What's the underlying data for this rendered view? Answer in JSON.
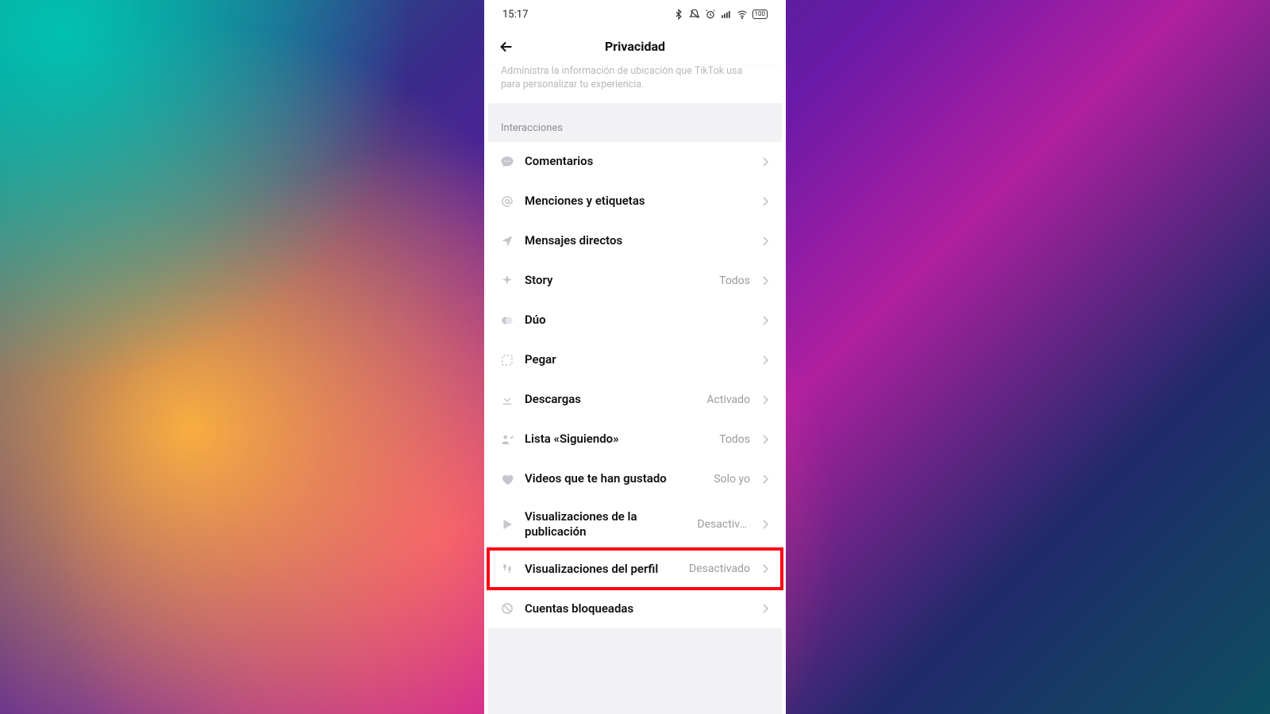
{
  "statusbar": {
    "time": "15:17",
    "battery": "100"
  },
  "header": {
    "title": "Privacidad"
  },
  "info_card": {
    "line1": "Administra la información de ubicación que TikTok usa",
    "line2": "para personalizar tu experiencia."
  },
  "section": {
    "title": "Interacciones"
  },
  "rows": {
    "comentarios": {
      "label": "Comentarios",
      "value": ""
    },
    "menciones": {
      "label": "Menciones y etiquetas",
      "value": ""
    },
    "mensajes": {
      "label": "Mensajes directos",
      "value": ""
    },
    "story": {
      "label": "Story",
      "value": "Todos"
    },
    "duo": {
      "label": "Dúo",
      "value": ""
    },
    "pegar": {
      "label": "Pegar",
      "value": ""
    },
    "descargas": {
      "label": "Descargas",
      "value": "Activado"
    },
    "siguiendo": {
      "label": "Lista «Siguiendo»",
      "value": "Todos"
    },
    "gustado": {
      "label": "Videos que te han gustado",
      "value": "Solo yo"
    },
    "vis_publicacion": {
      "label": "Visualizaciones de la publicación",
      "value": "Desactiva..."
    },
    "vis_perfil": {
      "label": "Visualizaciones del perfil",
      "value": "Desactivado"
    },
    "bloqueadas": {
      "label": "Cuentas bloqueadas",
      "value": ""
    }
  }
}
